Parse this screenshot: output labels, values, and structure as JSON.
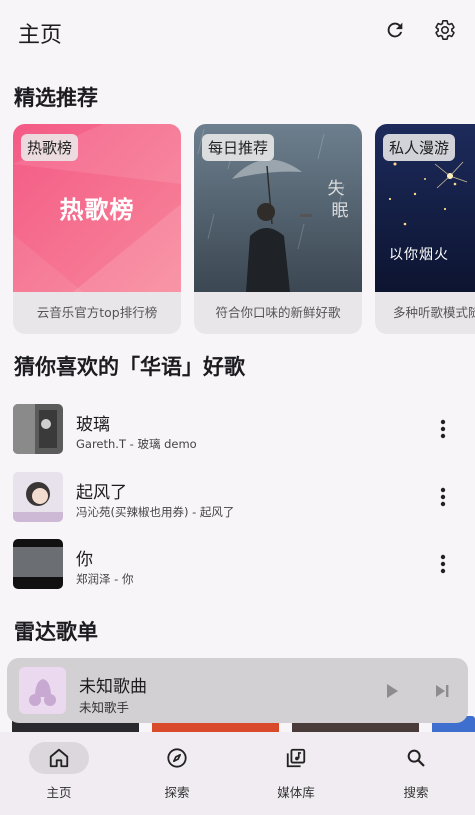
{
  "appbar": {
    "title": "主页",
    "refresh_icon": "refresh-icon",
    "settings_icon": "gear-icon"
  },
  "featured": {
    "title": "精选推荐",
    "cards": [
      {
        "tag": "热歌榜",
        "cover_text": "热歌榜",
        "desc": "云音乐官方top排行榜"
      },
      {
        "tag": "每日推荐",
        "desc": "符合你口味的新鲜好歌"
      },
      {
        "tag": "私人漫游",
        "cover_text": "以你烟火",
        "desc": "多种听歌模式随"
      }
    ]
  },
  "guess": {
    "title": "猜你喜欢的「华语」好歌",
    "songs": [
      {
        "name": "玻璃",
        "sub": "Gareth.T - 玻璃 demo"
      },
      {
        "name": "起风了",
        "sub": "冯沁苑(买辣椒也用券) - 起风了"
      },
      {
        "name": "你",
        "sub": "郑润泽 - 你"
      }
    ]
  },
  "radar": {
    "title": "雷达歌单"
  },
  "player": {
    "title": "未知歌曲",
    "artist": "未知歌手",
    "play_icon": "play-icon",
    "next_icon": "skip-next-icon"
  },
  "nav": {
    "items": [
      {
        "label": "主页",
        "icon": "home-icon",
        "active": true
      },
      {
        "label": "探索",
        "icon": "compass-icon",
        "active": false
      },
      {
        "label": "媒体库",
        "icon": "library-icon",
        "active": false
      },
      {
        "label": "搜索",
        "icon": "search-icon",
        "active": false
      }
    ]
  },
  "colors": {
    "background": "#f7f5f8",
    "hot_card": "#f36a8a",
    "player_bar": "#d2d0d3",
    "nav_bar": "#f0ecf1"
  }
}
